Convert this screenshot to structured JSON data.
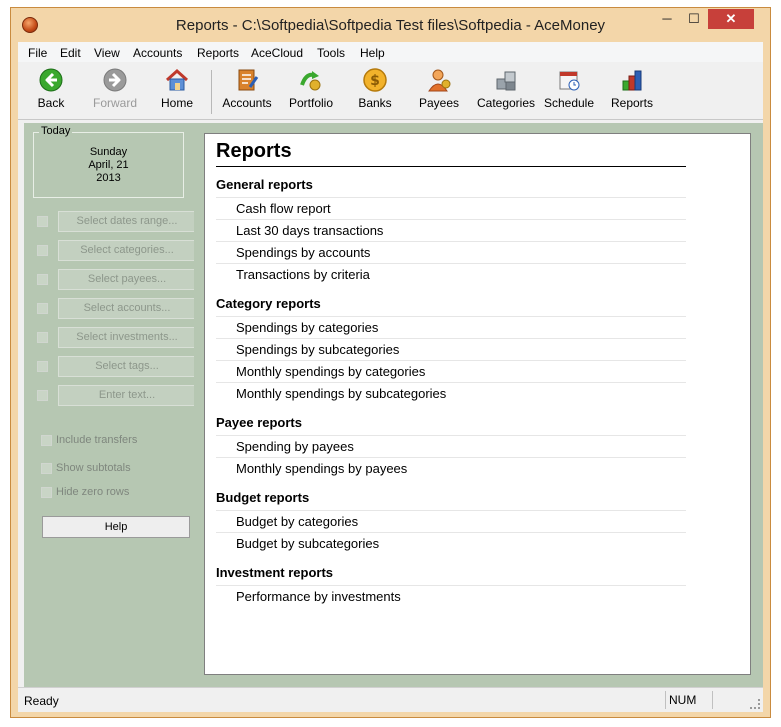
{
  "window": {
    "title": "Reports - C:\\Softpedia\\Softpedia Test files\\Softpedia - AceMoney",
    "minimize_label": "─",
    "maximize_label": "☐",
    "close_label": "✕"
  },
  "menu": [
    "File",
    "Edit",
    "View",
    "Accounts",
    "Reports",
    "AceCloud",
    "Tools",
    "Help"
  ],
  "toolbar": {
    "back": "Back",
    "forward": "Forward",
    "home": "Home",
    "accounts": "Accounts",
    "portfolio": "Portfolio",
    "banks": "Banks",
    "payees": "Payees",
    "categories": "Categories",
    "schedule": "Schedule",
    "reports": "Reports"
  },
  "sidebar": {
    "today_legend": "Today",
    "weekday": "Sunday",
    "date": "April, 21",
    "year": "2013",
    "filters": [
      "Select dates range...",
      "Select categories...",
      "Select payees...",
      "Select accounts...",
      "Select investments...",
      "Select tags...",
      "Enter text..."
    ],
    "options": [
      "Include transfers",
      "Show subtotals",
      "Hide zero rows"
    ],
    "help_label": "Help"
  },
  "content": {
    "title": "Reports",
    "sections": [
      {
        "title": "General reports",
        "items": [
          "Cash flow report",
          "Last 30 days transactions",
          "Spendings by accounts",
          "Transactions by criteria"
        ]
      },
      {
        "title": "Category reports",
        "items": [
          "Spendings by categories",
          "Spendings by subcategories",
          "Monthly spendings by categories",
          "Monthly spendings by subcategories"
        ]
      },
      {
        "title": "Payee reports",
        "items": [
          "Spending by payees",
          "Monthly spendings by payees"
        ]
      },
      {
        "title": "Budget reports",
        "items": [
          "Budget by categories",
          "Budget by subcategories"
        ]
      },
      {
        "title": "Investment reports",
        "items": [
          "Performance by investments"
        ]
      }
    ]
  },
  "status": {
    "text": "Ready",
    "num": "NUM"
  },
  "colors": {
    "window_frame": "#f3d6a9",
    "sidebar": "#b6c7b2",
    "close_button": "#c7403a"
  }
}
